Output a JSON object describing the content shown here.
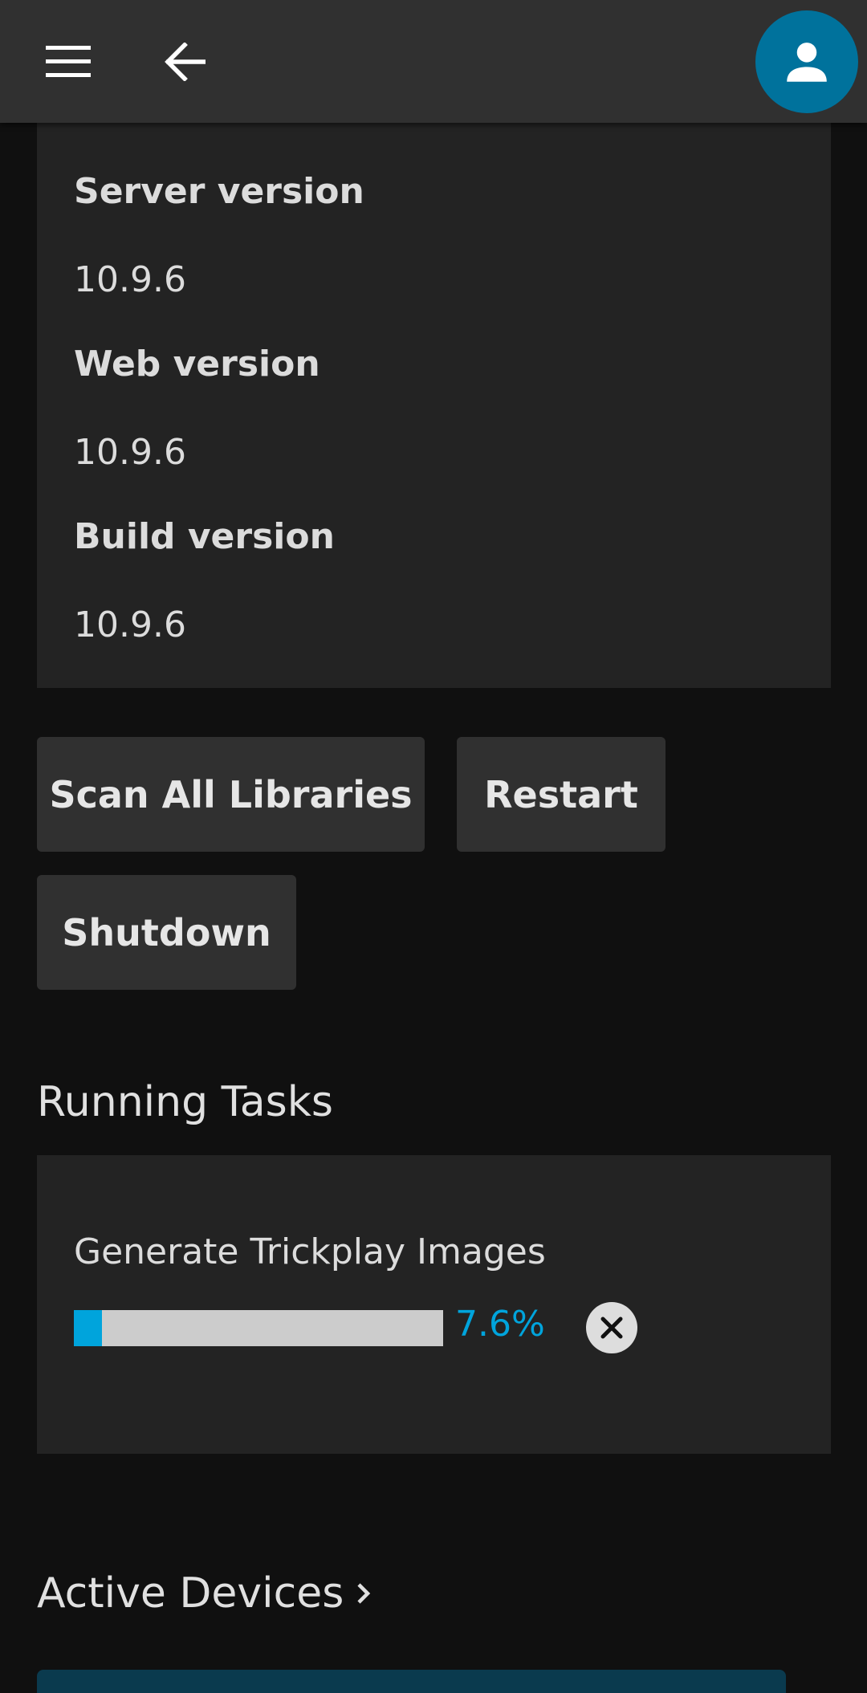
{
  "header": {
    "menu_icon": "hamburger-menu-icon",
    "back_icon": "arrow-left-icon",
    "avatar_icon": "user-icon",
    "avatar_color": "#00729c"
  },
  "server_info": {
    "server_version_label": "Server version",
    "server_version_value": "10.9.6",
    "web_version_label": "Web version",
    "web_version_value": "10.9.6",
    "build_version_label": "Build version",
    "build_version_value": "10.9.6"
  },
  "actions": {
    "scan_label": "Scan All Libraries",
    "restart_label": "Restart",
    "shutdown_label": "Shutdown"
  },
  "running_tasks": {
    "title": "Running Tasks",
    "tasks": [
      {
        "name": "Generate Trickplay Images",
        "progress_percent": 7.6,
        "progress_text": "7.6%",
        "cancel_icon": "close-circle-icon"
      }
    ]
  },
  "active_devices": {
    "title": "Active Devices",
    "chevron_icon": "chevron-right-icon"
  },
  "colors": {
    "accent": "#00a4dc",
    "header_bg": "#303030",
    "card_bg": "#232323",
    "page_bg": "#101010"
  }
}
